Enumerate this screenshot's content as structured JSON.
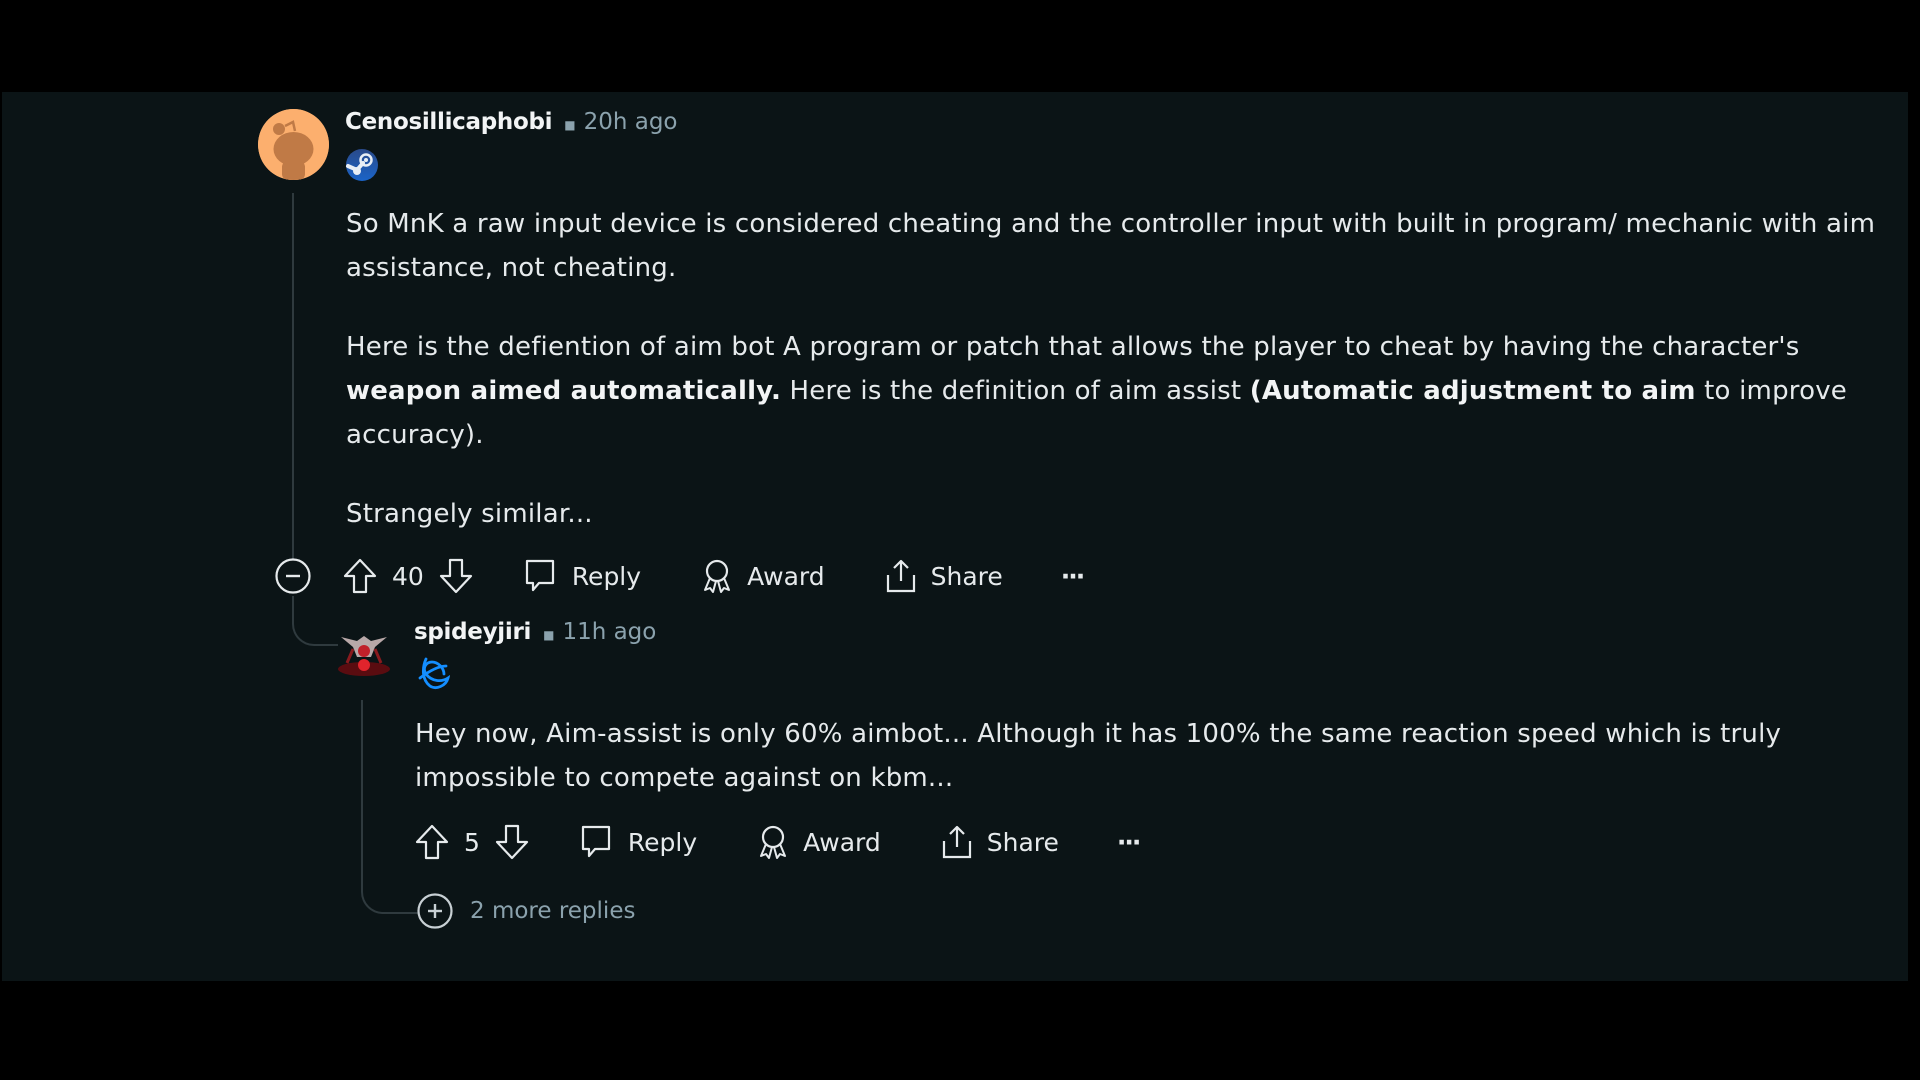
{
  "comments": [
    {
      "username": "Cenosillicaphobi",
      "timestamp": "20h ago",
      "flair_icon": "steam-icon",
      "avatar_color": "#fcaf6e",
      "paragraphs": [
        [
          {
            "text": "So MnK a raw input device is considered cheating and the controller input with built in program/ mechanic with aim assistance, not cheating.",
            "bold": false
          }
        ],
        [
          {
            "text": "Here is the defiention of aim bot A program or patch that allows the player to cheat by having the character's ",
            "bold": false
          },
          {
            "text": "weapon aimed automatically.",
            "bold": true
          },
          {
            "text": " Here is the definition of aim assist ",
            "bold": false
          },
          {
            "text": "(Automatic adjustment to aim",
            "bold": true
          },
          {
            "text": " to improve accuracy).",
            "bold": false
          }
        ],
        [
          {
            "text": "Strangely similar...",
            "bold": false
          }
        ]
      ],
      "votes": "40",
      "actions": {
        "reply": "Reply",
        "award": "Award",
        "share": "Share",
        "more": "···"
      }
    },
    {
      "username": "spideyjiri",
      "timestamp": "11h ago",
      "flair_icon": "battlenet-icon",
      "paragraphs": [
        [
          {
            "text": "Hey now, Aim-assist is only 60% aimbot... Although it has 100% the same reaction speed which is truly impossible to compete against on kbm...",
            "bold": false
          }
        ]
      ],
      "votes": "5",
      "actions": {
        "reply": "Reply",
        "award": "Award",
        "share": "Share",
        "more": "···"
      },
      "more_replies": "2 more replies"
    }
  ],
  "colors": {
    "background": "#0b1416",
    "text": "#e6eaec",
    "meta": "#8ba2ad",
    "thread_line": "#2f3a3e",
    "steam_blue": "#1b64c8",
    "battlenet_blue": "#148eff"
  }
}
